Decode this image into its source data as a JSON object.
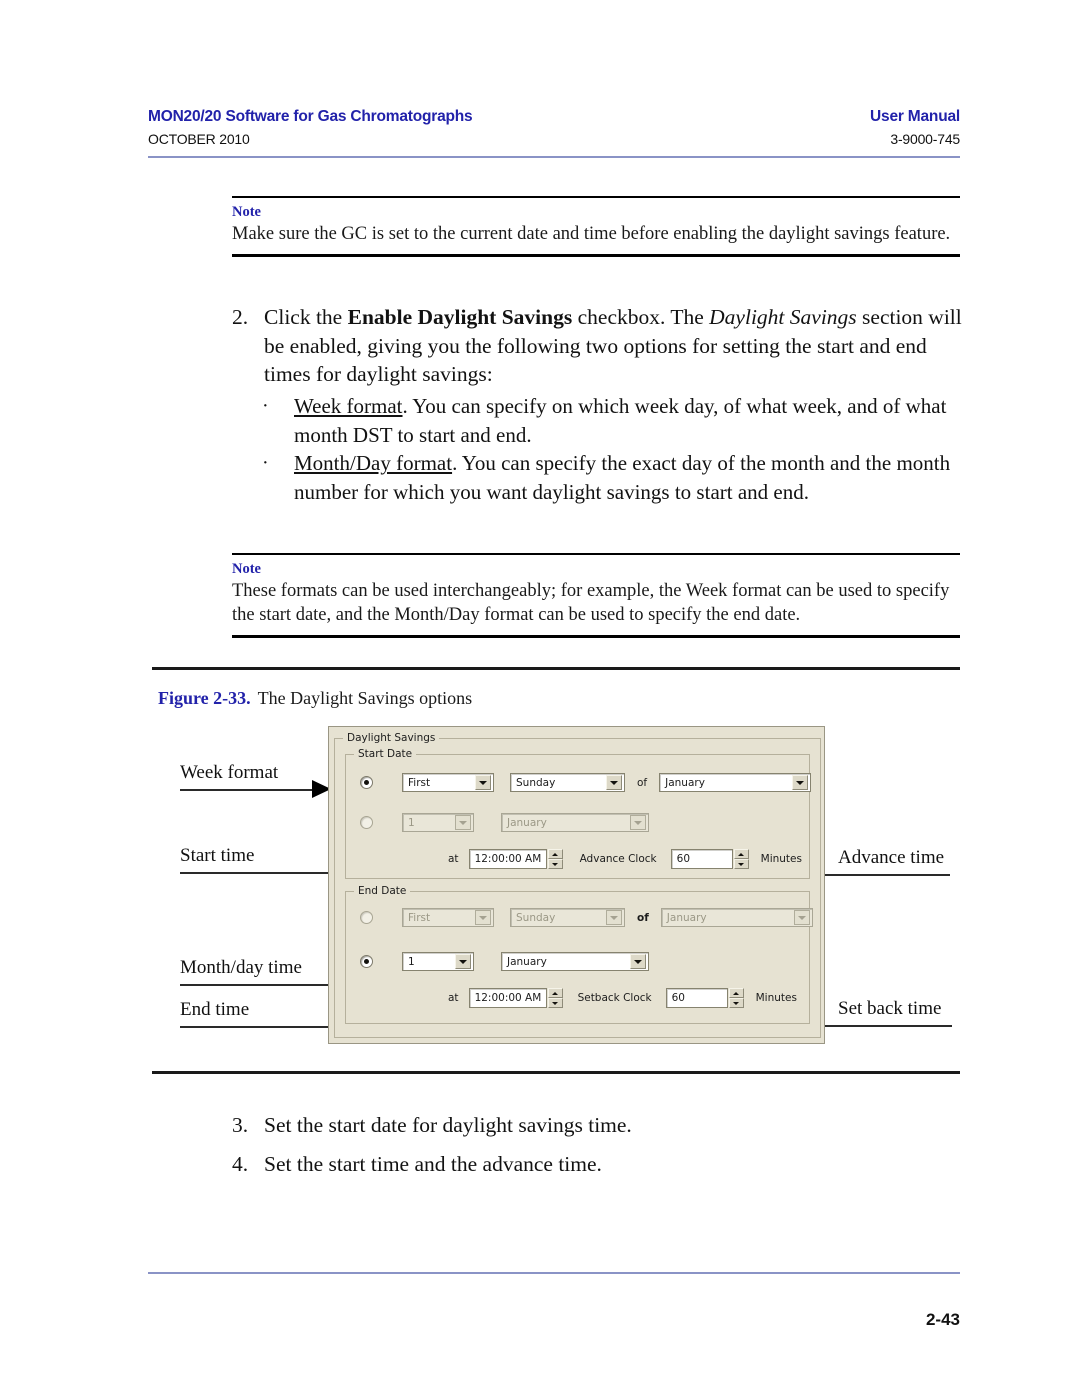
{
  "header": {
    "title": "MON20/20 Software for Gas Chromatographs",
    "date": "OCTOBER 2010",
    "manual_label": "User Manual",
    "doc_number": "3-9000-745"
  },
  "notes": [
    {
      "label": "Note",
      "text": "Make sure the GC is set to the current date and time before enabling the daylight savings feature."
    },
    {
      "label": "Note",
      "text": "These formats can be used interchangeably; for example, the Week format can be used to specify the start date, and the Month/Day format can be used to specify the end date."
    }
  ],
  "step2": {
    "number": "2.",
    "part1": "Click the ",
    "bold1": "Enable Daylight Savings",
    "part2": " checkbox.  The ",
    "italic1": "Daylight Savings",
    "part3": " section will be enabled, giving you the following two options for setting the start and end times for daylight savings:"
  },
  "bullets": [
    {
      "mark": "·",
      "lead": "Week format",
      "rest": ". You can specify on which week day, of what week, and of what month DST to start and end."
    },
    {
      "mark": "·",
      "lead": "Month/Day format",
      "rest": ". You can specify the exact day of the month and the month number for which you want daylight savings to start and end."
    }
  ],
  "step3": {
    "number": "3.",
    "text": "Set the start date for daylight savings time."
  },
  "step4": {
    "number": "4.",
    "text": "Set the start time and the advance time."
  },
  "figure": {
    "number": "Figure 2-33.",
    "caption": "The Daylight Savings options"
  },
  "annotations": {
    "week_format": "Week format",
    "start_time": "Start time",
    "month_day_time": "Month/day time",
    "end_time": "End time",
    "advance_time": "Advance time",
    "set_back_time": "Set back time"
  },
  "dialog": {
    "group_title": "Daylight Savings",
    "start_date": {
      "group_title": "Start Date",
      "week_row": {
        "selected": true,
        "week": "First",
        "weekday": "Sunday",
        "of_label": "of",
        "month": "January"
      },
      "monthday_row": {
        "selected": false,
        "day": "1",
        "month": "January"
      },
      "time_row": {
        "at_label": "at",
        "time": "12:00:00 AM",
        "clock_label": "Advance Clock",
        "amount": "60",
        "units": "Minutes"
      }
    },
    "end_date": {
      "group_title": "End Date",
      "week_row": {
        "selected": false,
        "week": "First",
        "weekday": "Sunday",
        "of_label": "of",
        "month": "January"
      },
      "monthday_row": {
        "selected": true,
        "day": "1",
        "month": "January"
      },
      "time_row": {
        "at_label": "at",
        "time": "12:00:00 AM",
        "clock_label": "Setback Clock",
        "amount": "60",
        "units": "Minutes"
      }
    }
  },
  "footer": {
    "page_number": "2-43"
  },
  "colors": {
    "accent_blue": "#2222aa",
    "rule_blue": "#8a93c6",
    "dialog_bg": "#e6e2d2"
  }
}
